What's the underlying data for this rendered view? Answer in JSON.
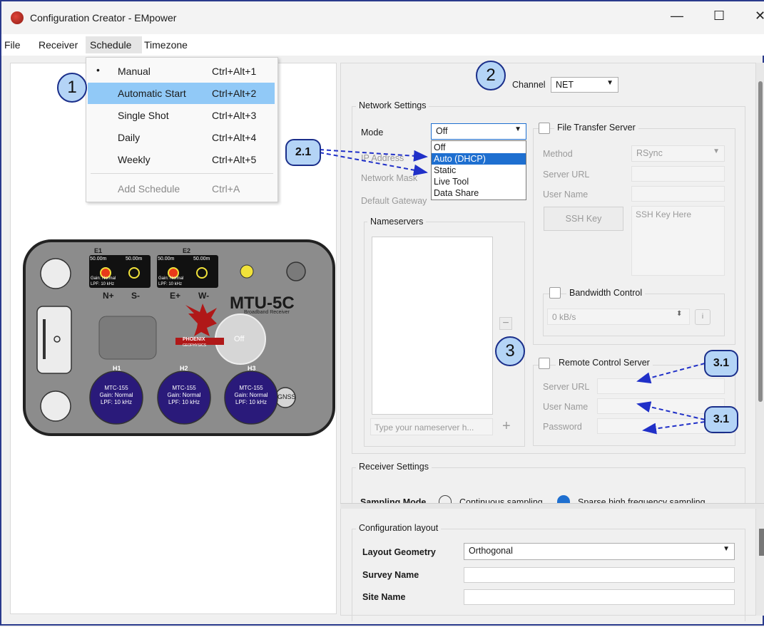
{
  "window": {
    "title": "Configuration Creator - EMpower",
    "minimize": "—",
    "maximize": "☐",
    "close": "✕"
  },
  "menubar": [
    "File",
    "Receiver",
    "Schedule",
    "Timezone"
  ],
  "schedule_menu": {
    "items": [
      {
        "label": "Manual",
        "shortcut": "Ctrl+Alt+1",
        "bullet": "•"
      },
      {
        "label": "Automatic Start",
        "shortcut": "Ctrl+Alt+2"
      },
      {
        "label": "Single Shot",
        "shortcut": "Ctrl+Alt+3"
      },
      {
        "label": "Daily",
        "shortcut": "Ctrl+Alt+4"
      },
      {
        "label": "Weekly",
        "shortcut": "Ctrl+Alt+5"
      },
      {
        "label": "Add Schedule",
        "shortcut": "Ctrl+A"
      }
    ]
  },
  "device": {
    "model": "MTU-5C",
    "subtitle": "Broadband Receiver",
    "brand": "PHOENIX",
    "brand_sub": "GEOPHYSICS",
    "power_label": "Off",
    "gnss_label": "GNSS",
    "e_channels": [
      {
        "name": "E1",
        "left_len": "50.00m",
        "right_len": "50.00m",
        "gain": "Gain: Normal",
        "lpf": "LPF: 10 kHz",
        "pos": "N+",
        "neg": "S-"
      },
      {
        "name": "E2",
        "left_len": "50.00m",
        "right_len": "50.00m",
        "gain": "Gain: Normal",
        "lpf": "LPF: 10 kHz",
        "pos": "E+",
        "neg": "W-"
      }
    ],
    "h_channels": [
      {
        "name": "H1",
        "sensor": "MTC-155",
        "gain": "Gain: Normal",
        "lpf": "LPF: 10 kHz"
      },
      {
        "name": "H2",
        "sensor": "MTC-155",
        "gain": "Gain: Normal",
        "lpf": "LPF: 10 kHz"
      },
      {
        "name": "H3",
        "sensor": "MTC-155",
        "gain": "Gain: Normal",
        "lpf": "LPF: 10 kHz"
      }
    ]
  },
  "channel": {
    "label": "Channel",
    "value": "NET"
  },
  "network": {
    "group_label": "Network Settings",
    "mode_label": "Mode",
    "mode_value": "Off",
    "mode_options": [
      "Off",
      "Auto (DHCP)",
      "Static",
      "Live Tool",
      "Data Share"
    ],
    "ip_label": "IP Address",
    "mask_label": "Network Mask",
    "gateway_label": "Default Gateway",
    "nameservers_label": "Nameservers",
    "nameserver_placeholder": "Type your nameserver h...",
    "minus": "−",
    "plus": "+"
  },
  "file_transfer": {
    "label": "File Transfer Server",
    "method_label": "Method",
    "method_value": "RSync",
    "server_url_label": "Server URL",
    "user_name_label": "User Name",
    "ssh_button": "SSH Key",
    "ssh_placeholder": "SSH Key Here"
  },
  "bandwidth": {
    "label": "Bandwidth Control",
    "value": "0 kB/s",
    "info": "i"
  },
  "remote_control": {
    "label": "Remote Control Server",
    "server_url_label": "Server URL",
    "user_name_label": "User Name",
    "password_label": "Password"
  },
  "receiver_settings": {
    "label": "Receiver Settings",
    "sampling_mode_label": "Sampling Mode",
    "continuous": "Continuous sampling",
    "sparse": "Sparse high frequency sampling"
  },
  "configuration_layout": {
    "label": "Configuration layout",
    "layout_geometry_label": "Layout Geometry",
    "layout_geometry_value": "Orthogonal",
    "survey_name_label": "Survey Name",
    "site_name_label": "Site Name"
  },
  "callouts": {
    "c1": "1",
    "c2": "2",
    "c21": "2.1",
    "c3": "3",
    "c31a": "3.1",
    "c31b": "3.1"
  },
  "colors": {
    "accent": "#1e6fd0",
    "callout_fill": "#b4d4f6",
    "callout_border": "#1a2e8a",
    "device_body": "#8c8c8c",
    "sensor": "#2a1a7a"
  }
}
